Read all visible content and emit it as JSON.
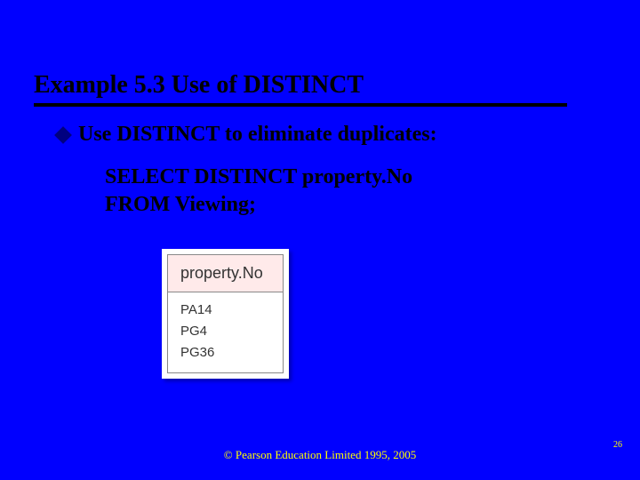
{
  "title": "Example 5.3  Use of DISTINCT",
  "bullet": "Use DISTINCT to eliminate duplicates:",
  "sql": {
    "line1": "SELECT DISTINCT property.No",
    "line2": "FROM Viewing;"
  },
  "table": {
    "header": "property.No",
    "rows": [
      "PA14",
      "PG4",
      "PG36"
    ]
  },
  "footer": "© Pearson Education Limited 1995, 2005",
  "page_number": "26"
}
